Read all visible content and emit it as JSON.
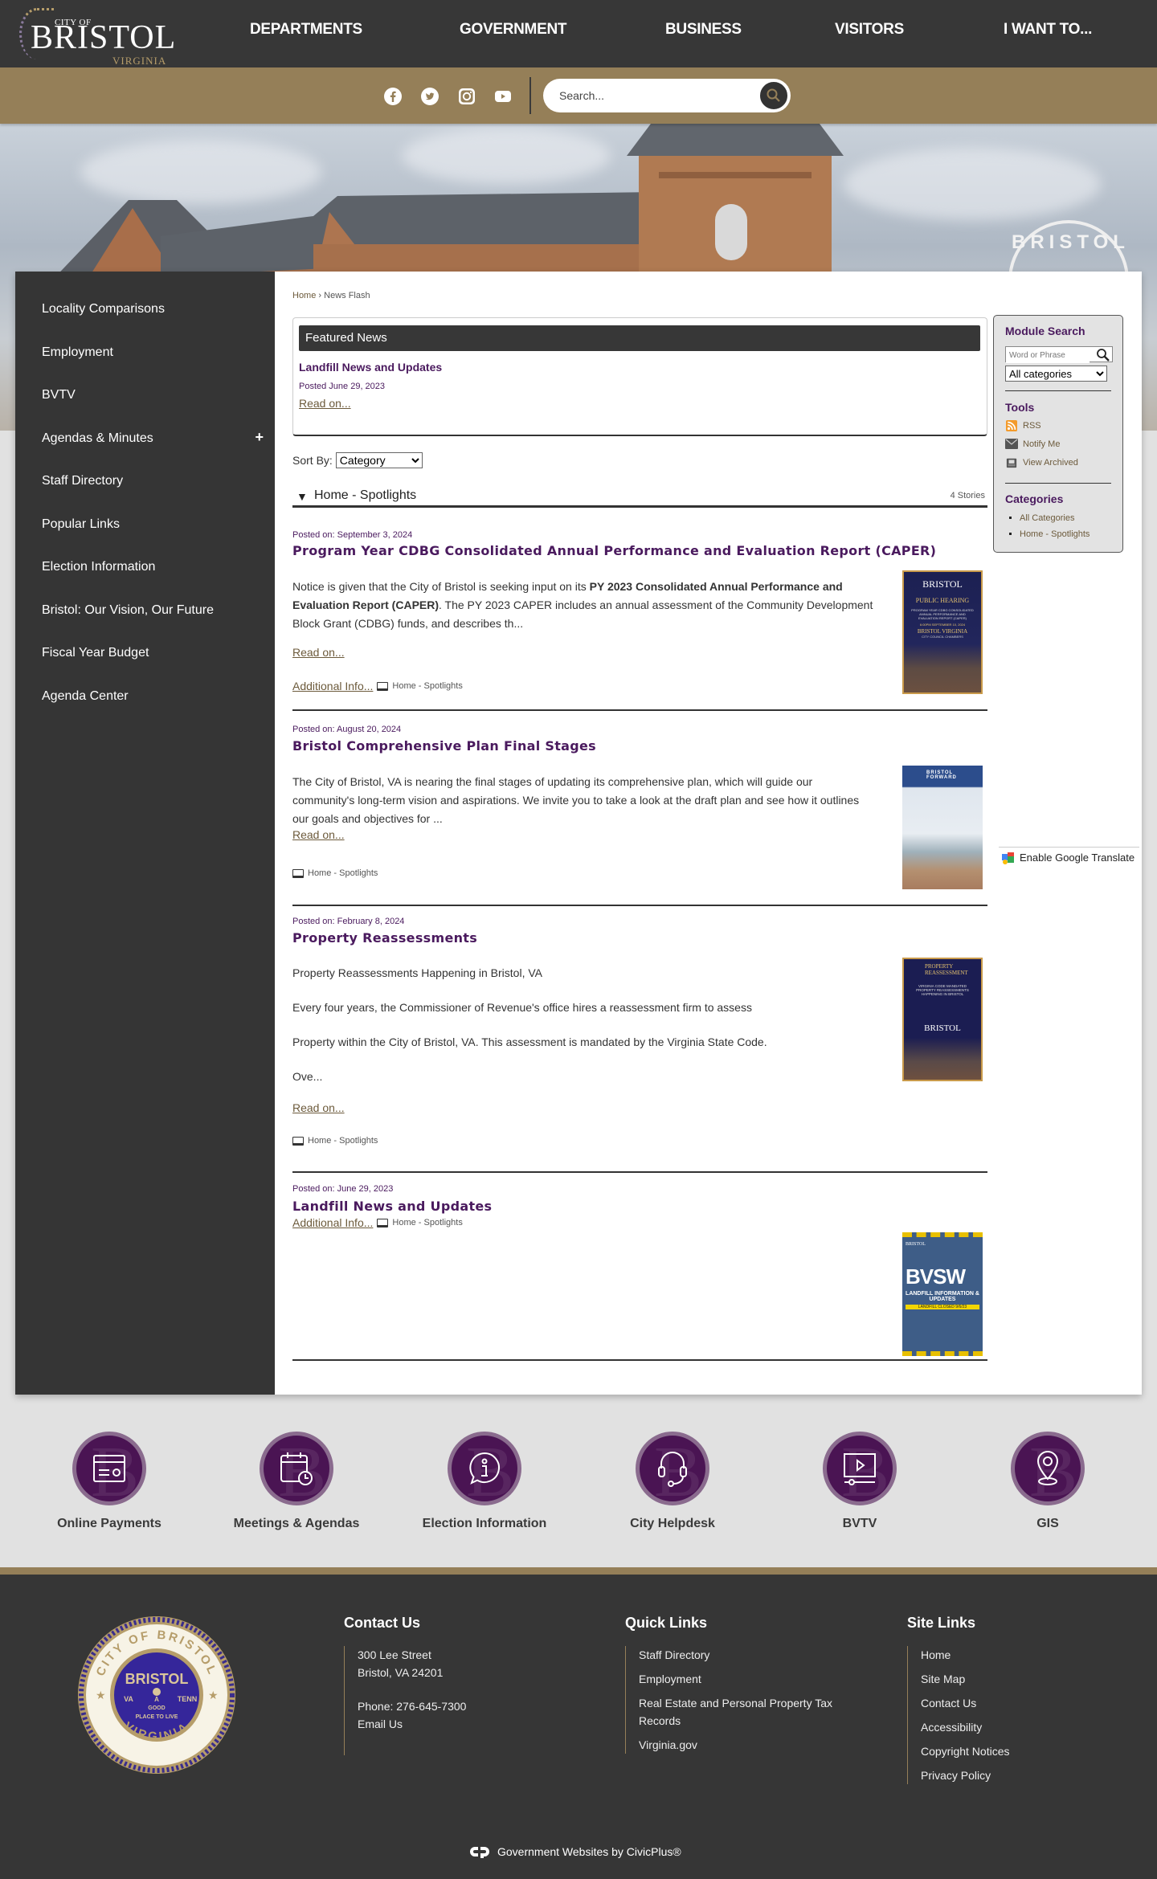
{
  "header": {
    "logo": {
      "city_of": "CITY OF",
      "name": "BRISTOL",
      "state": "VIRGINIA"
    },
    "nav": [
      "DEPARTMENTS",
      "GOVERNMENT",
      "BUSINESS",
      "VISITORS",
      "I WANT TO..."
    ],
    "social": [
      "facebook-icon",
      "twitter-icon",
      "instagram-icon",
      "youtube-icon"
    ],
    "search": {
      "placeholder": "Search..."
    }
  },
  "hero": {
    "sign_text": "BRISTOL"
  },
  "sidebar": {
    "items": [
      {
        "label": "Locality Comparisons"
      },
      {
        "label": "Employment"
      },
      {
        "label": "BVTV"
      },
      {
        "label": "Agendas & Minutes",
        "expand": "+"
      },
      {
        "label": "Staff Directory"
      },
      {
        "label": "Popular Links"
      },
      {
        "label": "Election Information"
      },
      {
        "label": "Bristol: Our Vision, Our Future"
      },
      {
        "label": "Fiscal Year Budget"
      },
      {
        "label": "Agenda Center"
      }
    ]
  },
  "breadcrumb": {
    "home": "Home",
    "sep": "›",
    "current": "News Flash"
  },
  "featured": {
    "heading": "Featured News",
    "title": "Landfill News and Updates",
    "date": "Posted June 29, 2023",
    "read_on": "Read on..."
  },
  "sort": {
    "label": "Sort By:",
    "selected": "Category"
  },
  "category": {
    "name": "Home - Spotlights",
    "count": "4 Stories"
  },
  "articles": [
    {
      "date": "Posted on: September 3, 2024",
      "title": "Program Year CDBG Consolidated Annual Performance and Evaluation Report (CAPER)",
      "body_pre": "Notice is given that the City of Bristol is seeking input on its ",
      "body_bold": "PY 2023 Consolidated Annual Performance and Evaluation Report (CAPER)",
      "body_post": ". The PY 2023 CAPER includes an annual assessment of the Community Development Block Grant (CDBG) funds, and describes th...",
      "read_on": "Read on...",
      "additional": "Additional Info...",
      "category": "Home - Spotlights",
      "thumb": {
        "brand": "BRISTOL",
        "heading": "PUBLIC HEARING",
        "lines": "PROGRAM YEAR CDBG CONSOLIDATED ANNUAL PERFORMANCE AND EVALUATION REPORT (CAPER)",
        "date": "6:00PM SEPTEMBER 10, 2024",
        "place": "BRISTOL VIRGINIA",
        "sub": "CITY COUNCIL CHAMBERS"
      }
    },
    {
      "date": "Posted on: August 20, 2024",
      "title": "Bristol Comprehensive Plan Final Stages",
      "body": "The City of Bristol, VA is nearing the final stages of updating its comprehensive plan, which will guide our community's long-term vision and aspirations. We invite you to take a look at the draft plan and see how it outlines our goals and objectives for ...",
      "read_on": "Read on...",
      "category": "Home - Spotlights",
      "thumb": {
        "brand": "BRISTOL FORWARD"
      }
    },
    {
      "date": "Posted on: February 8, 2024",
      "title": "Property Reassessments",
      "paragraphs": [
        "Property Reassessments Happening in Bristol, VA",
        "Every four years, the Commissioner of Revenue's office hires a reassessment firm to assess",
        "Property within the City of Bristol, VA. This assessment is mandated by the Virginia State Code.",
        "Ove..."
      ],
      "read_on": "Read on...",
      "category": "Home - Spotlights",
      "thumb": {
        "heading": "PROPERTY REASSESSMENT",
        "lines": "VIRGINIA CODE MANDATED PROPERTY REASSESSMENTS HAPPENING IN BRISTOL",
        "brand": "BRISTOL"
      }
    },
    {
      "date": "Posted on: June 29, 2023",
      "title": "Landfill News and Updates",
      "additional": "Additional Info...",
      "category": "Home - Spotlights",
      "thumb": {
        "brand": "BRISTOL",
        "heading": "BVSW",
        "lines": "LANDFILL INFORMATION & UPDATES",
        "banner": "LANDFILL CLOSED 9/6/23"
      }
    }
  ],
  "module": {
    "search_title": "Module Search",
    "search_placeholder": "Word or Phrase",
    "category_selected": "All categories",
    "tools_title": "Tools",
    "tools": [
      "RSS",
      "Notify Me",
      "View Archived"
    ],
    "categories_title": "Categories",
    "categories": [
      "All Categories",
      "Home - Spotlights"
    ]
  },
  "translate": {
    "label": "Enable Google Translate"
  },
  "quick_links": [
    {
      "label": "Online Payments",
      "icon": "payment-card-icon"
    },
    {
      "label": "Meetings & Agendas",
      "icon": "calendar-clock-icon"
    },
    {
      "label": "Election Information",
      "icon": "info-bubble-icon"
    },
    {
      "label": "City Helpdesk",
      "icon": "headset-icon"
    },
    {
      "label": "BVTV",
      "icon": "video-player-icon"
    },
    {
      "label": "GIS",
      "icon": "map-pin-icon"
    }
  ],
  "footer": {
    "seal": {
      "ring": "CITY OF BRISTOL",
      "bottom": "VIRGINIA",
      "center": "BRISTOL",
      "left": "VA",
      "right": "TENN",
      "motto1": "A",
      "motto2": "GOOD",
      "motto3": "PLACE TO LIVE"
    },
    "contact": {
      "title": "Contact Us",
      "address1": "300 Lee Street",
      "address2": "Bristol, VA 24201",
      "phone": "Phone: 276-645-7300",
      "email": "Email Us"
    },
    "quick": {
      "title": "Quick Links",
      "links": [
        "Staff Directory",
        "Employment",
        "Real Estate and Personal Property Tax Records",
        "Virginia.gov"
      ]
    },
    "site": {
      "title": "Site Links",
      "links": [
        "Home",
        "Site Map",
        "Contact Us",
        "Accessibility",
        "Copyright Notices",
        "Privacy Policy"
      ]
    },
    "credit": "Government Websites by CivicPlus®"
  },
  "colors": {
    "dark": "#373737",
    "gold": "#957f58",
    "purple": "#4a1a5e",
    "link_brown": "#6c5a3b"
  }
}
